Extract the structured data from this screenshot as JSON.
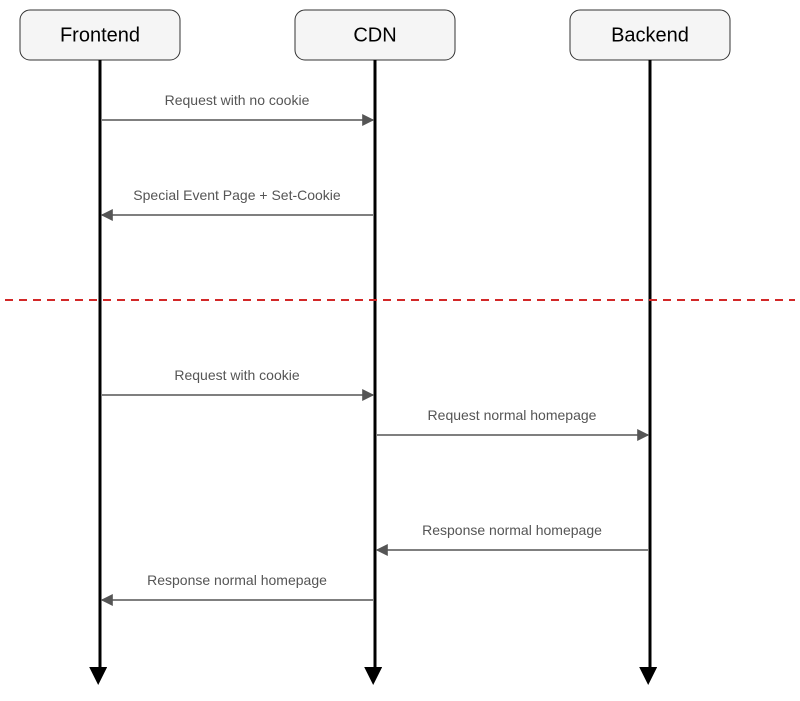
{
  "participants": {
    "frontend": "Frontend",
    "cdn": "CDN",
    "backend": "Backend"
  },
  "messages": {
    "m1": "Request with no cookie",
    "m2": "Special Event Page + Set-Cookie",
    "m3": "Request with cookie",
    "m4": "Request normal homepage",
    "m5": "Response normal homepage",
    "m6": "Response normal homepage"
  }
}
